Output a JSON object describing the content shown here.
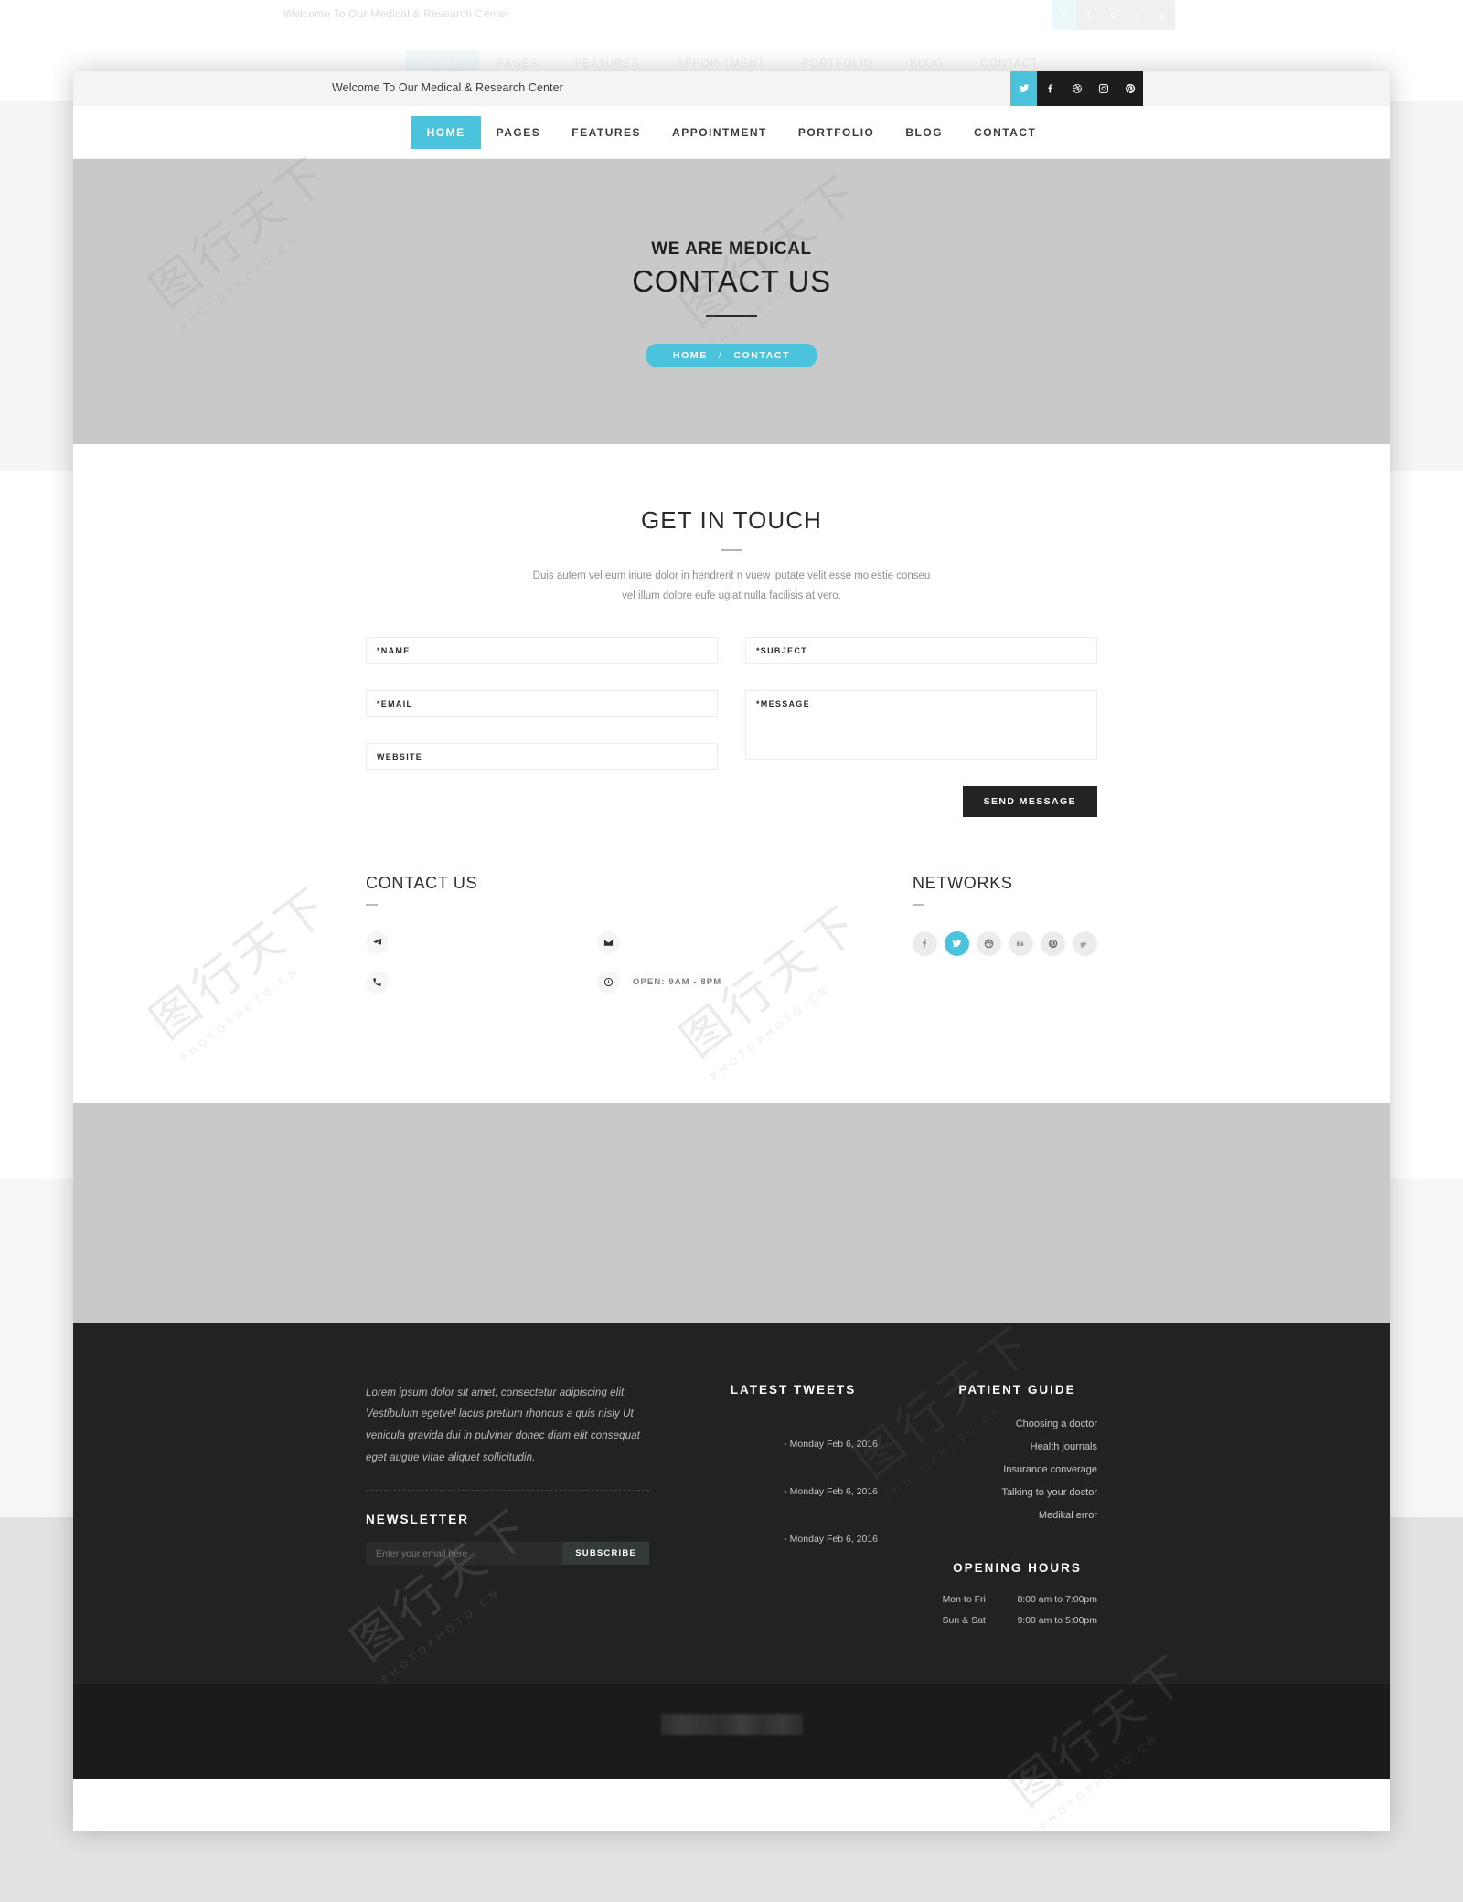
{
  "topbar": {
    "welcome": "Welcome To Our Medical & Research Center",
    "social": [
      {
        "name": "twitter-icon",
        "label": "Twitter"
      },
      {
        "name": "facebook-icon",
        "label": "Facebook"
      },
      {
        "name": "dribbble-icon",
        "label": "Dribbble"
      },
      {
        "name": "instagram-icon",
        "label": "Instagram"
      },
      {
        "name": "pinterest-icon",
        "label": "Pinterest"
      }
    ]
  },
  "nav": {
    "items": [
      {
        "label": "HOME",
        "active": true
      },
      {
        "label": "PAGES",
        "active": false
      },
      {
        "label": "FEATURES",
        "active": false
      },
      {
        "label": "APPOINTMENT",
        "active": false
      },
      {
        "label": "PORTFOLIO",
        "active": false
      },
      {
        "label": "BLOG",
        "active": false
      },
      {
        "label": "CONTACT",
        "active": false
      }
    ]
  },
  "hero": {
    "subtitle": "WE ARE MEDICAL",
    "title": "CONTACT US",
    "crumb_home": "HOME",
    "crumb_sep": "/",
    "crumb_current": "CONTACT"
  },
  "getintouch": {
    "title": "GET IN TOUCH",
    "lead_line1": "Duis autem vel eum iriure dolor in hendrerit n vuew lputate velit esse molestie conseu",
    "lead_line2": "vel illum dolore eufe ugiat nulla facilisis at vero.",
    "fields": {
      "name": "*NAME",
      "email": "*EMAIL",
      "website": "WEBSITE",
      "subject": "*SUBJECT",
      "message": "*MESSAGE"
    },
    "submit_label": "SEND MESSAGE"
  },
  "contact": {
    "title": "CONTACT US",
    "items": [
      {
        "icon": "location-icon",
        "text": ""
      },
      {
        "icon": "phone-icon",
        "text": ""
      },
      {
        "icon": "email-icon",
        "text": ""
      },
      {
        "icon": "clock-icon",
        "text": "OPEN: 9AM - 8PM"
      }
    ]
  },
  "networks": {
    "title": "NETWORKS",
    "items": [
      {
        "name": "facebook-icon",
        "active": false
      },
      {
        "name": "twitter-icon",
        "active": true
      },
      {
        "name": "dribbble-icon",
        "active": false
      },
      {
        "name": "behance-icon",
        "active": false
      },
      {
        "name": "pinterest-icon",
        "active": false
      },
      {
        "name": "googleplus-icon",
        "active": false
      }
    ]
  },
  "footer": {
    "about": "Lorem ipsum dolor sit amet, consectetur adipiscing elit. Vestibulum egetvel lacus pretium rhoncus a quis nisly Ut vehicula gravida dui in pulvinar donec diam elit consequat eget augue vitae aliquet sollicitudin.",
    "newsletter_title": "NEWSLETTER",
    "newsletter_placeholder": "Enter your email here",
    "newsletter_value": "",
    "subscribe_label": "SUBSCRIBE",
    "tweets_title": "LATEST TWEETS",
    "tweets": [
      {
        "text": "",
        "date": "- Monday Feb 6, 2016"
      },
      {
        "text": "",
        "date": "- Monday Feb 6, 2016"
      },
      {
        "text": "",
        "date": "- Monday Feb 6, 2016"
      }
    ],
    "guide_title": "PATIENT GUIDE",
    "guide": [
      "Choosing a doctor",
      "Health journals",
      "Insurance converage",
      "Talking to your doctor",
      "Medikal error"
    ],
    "hours_title": "OPENING HOURS",
    "hours": [
      {
        "days": "Mon to Fri",
        "time": "8:00 am to 7:00pm"
      },
      {
        "days": "Sun & Sat",
        "time": "9:00 am to 5:00pm"
      }
    ],
    "copyright": ""
  },
  "colors": {
    "accent": "#4cc3dd",
    "dark": "#232323",
    "footer_bg": "#222222",
    "hero_bg": "#c9c9c9",
    "required": "#b03a3a"
  },
  "watermark": {
    "latin": "PHOTOPHOTO.CN",
    "cjk": "图行天下"
  }
}
